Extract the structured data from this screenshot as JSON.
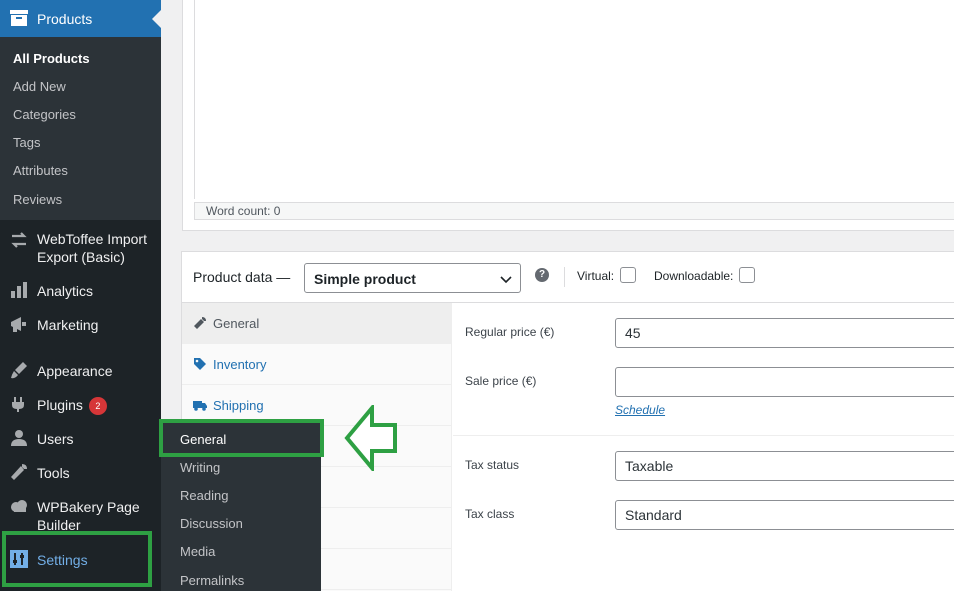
{
  "sidebar": {
    "products_label": "Products",
    "products_icon": "archive-box-icon",
    "submenu": [
      "All Products",
      "Add New",
      "Categories",
      "Tags",
      "Attributes",
      "Reviews"
    ],
    "items": {
      "webtoffee": "WebToffee Import Export (Basic)",
      "analytics": "Analytics",
      "marketing": "Marketing",
      "appearance": "Appearance",
      "plugins": "Plugins",
      "plugins_badge": "2",
      "users": "Users",
      "tools": "Tools",
      "wpbakery": "WPBakery Page Builder",
      "settings": "Settings"
    }
  },
  "settings_flyout": [
    "General",
    "Writing",
    "Reading",
    "Discussion",
    "Media",
    "Permalinks"
  ],
  "editor": {
    "word_count": "Word count: 0"
  },
  "product_data": {
    "title": "Product data —",
    "type_select": "Simple product",
    "help": "?",
    "virtual_label": "Virtual:",
    "downloadable_label": "Downloadable:",
    "tabs": [
      "General",
      "Inventory",
      "Shipping"
    ],
    "fields": {
      "regular_price_label": "Regular price (€)",
      "regular_price_value": "45",
      "sale_price_label": "Sale price (€)",
      "sale_price_value": "",
      "schedule_link": "Schedule",
      "tax_status_label": "Tax status",
      "tax_status_value": "Taxable",
      "tax_class_label": "Tax class",
      "tax_class_value": "Standard"
    }
  },
  "colors": {
    "admin_blue": "#2271b1",
    "sidebar_bg": "#1d2327",
    "highlight_green": "#2ea043",
    "badge_red": "#d63638"
  }
}
